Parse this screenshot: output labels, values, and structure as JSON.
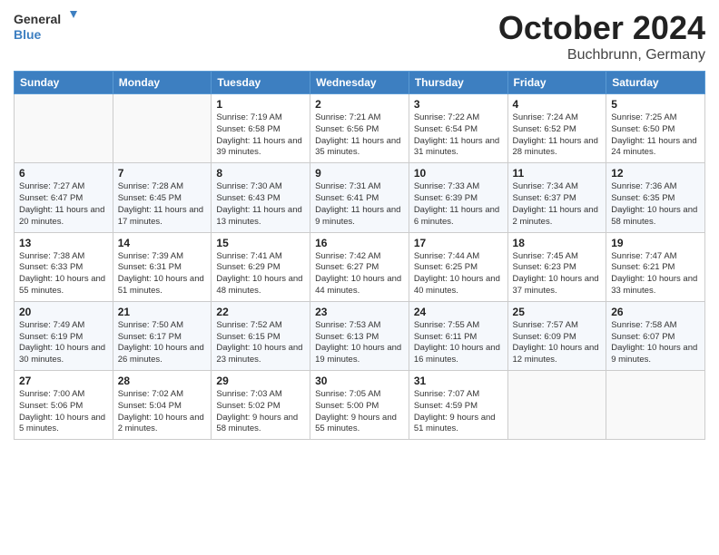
{
  "logo": {
    "line1": "General",
    "line2": "Blue"
  },
  "title": "October 2024",
  "subtitle": "Buchbrunn, Germany",
  "weekdays": [
    "Sunday",
    "Monday",
    "Tuesday",
    "Wednesday",
    "Thursday",
    "Friday",
    "Saturday"
  ],
  "weeks": [
    [
      {
        "day": "",
        "sunrise": "",
        "sunset": "",
        "daylight": ""
      },
      {
        "day": "",
        "sunrise": "",
        "sunset": "",
        "daylight": ""
      },
      {
        "day": "1",
        "sunrise": "Sunrise: 7:19 AM",
        "sunset": "Sunset: 6:58 PM",
        "daylight": "Daylight: 11 hours and 39 minutes."
      },
      {
        "day": "2",
        "sunrise": "Sunrise: 7:21 AM",
        "sunset": "Sunset: 6:56 PM",
        "daylight": "Daylight: 11 hours and 35 minutes."
      },
      {
        "day": "3",
        "sunrise": "Sunrise: 7:22 AM",
        "sunset": "Sunset: 6:54 PM",
        "daylight": "Daylight: 11 hours and 31 minutes."
      },
      {
        "day": "4",
        "sunrise": "Sunrise: 7:24 AM",
        "sunset": "Sunset: 6:52 PM",
        "daylight": "Daylight: 11 hours and 28 minutes."
      },
      {
        "day": "5",
        "sunrise": "Sunrise: 7:25 AM",
        "sunset": "Sunset: 6:50 PM",
        "daylight": "Daylight: 11 hours and 24 minutes."
      }
    ],
    [
      {
        "day": "6",
        "sunrise": "Sunrise: 7:27 AM",
        "sunset": "Sunset: 6:47 PM",
        "daylight": "Daylight: 11 hours and 20 minutes."
      },
      {
        "day": "7",
        "sunrise": "Sunrise: 7:28 AM",
        "sunset": "Sunset: 6:45 PM",
        "daylight": "Daylight: 11 hours and 17 minutes."
      },
      {
        "day": "8",
        "sunrise": "Sunrise: 7:30 AM",
        "sunset": "Sunset: 6:43 PM",
        "daylight": "Daylight: 11 hours and 13 minutes."
      },
      {
        "day": "9",
        "sunrise": "Sunrise: 7:31 AM",
        "sunset": "Sunset: 6:41 PM",
        "daylight": "Daylight: 11 hours and 9 minutes."
      },
      {
        "day": "10",
        "sunrise": "Sunrise: 7:33 AM",
        "sunset": "Sunset: 6:39 PM",
        "daylight": "Daylight: 11 hours and 6 minutes."
      },
      {
        "day": "11",
        "sunrise": "Sunrise: 7:34 AM",
        "sunset": "Sunset: 6:37 PM",
        "daylight": "Daylight: 11 hours and 2 minutes."
      },
      {
        "day": "12",
        "sunrise": "Sunrise: 7:36 AM",
        "sunset": "Sunset: 6:35 PM",
        "daylight": "Daylight: 10 hours and 58 minutes."
      }
    ],
    [
      {
        "day": "13",
        "sunrise": "Sunrise: 7:38 AM",
        "sunset": "Sunset: 6:33 PM",
        "daylight": "Daylight: 10 hours and 55 minutes."
      },
      {
        "day": "14",
        "sunrise": "Sunrise: 7:39 AM",
        "sunset": "Sunset: 6:31 PM",
        "daylight": "Daylight: 10 hours and 51 minutes."
      },
      {
        "day": "15",
        "sunrise": "Sunrise: 7:41 AM",
        "sunset": "Sunset: 6:29 PM",
        "daylight": "Daylight: 10 hours and 48 minutes."
      },
      {
        "day": "16",
        "sunrise": "Sunrise: 7:42 AM",
        "sunset": "Sunset: 6:27 PM",
        "daylight": "Daylight: 10 hours and 44 minutes."
      },
      {
        "day": "17",
        "sunrise": "Sunrise: 7:44 AM",
        "sunset": "Sunset: 6:25 PM",
        "daylight": "Daylight: 10 hours and 40 minutes."
      },
      {
        "day": "18",
        "sunrise": "Sunrise: 7:45 AM",
        "sunset": "Sunset: 6:23 PM",
        "daylight": "Daylight: 10 hours and 37 minutes."
      },
      {
        "day": "19",
        "sunrise": "Sunrise: 7:47 AM",
        "sunset": "Sunset: 6:21 PM",
        "daylight": "Daylight: 10 hours and 33 minutes."
      }
    ],
    [
      {
        "day": "20",
        "sunrise": "Sunrise: 7:49 AM",
        "sunset": "Sunset: 6:19 PM",
        "daylight": "Daylight: 10 hours and 30 minutes."
      },
      {
        "day": "21",
        "sunrise": "Sunrise: 7:50 AM",
        "sunset": "Sunset: 6:17 PM",
        "daylight": "Daylight: 10 hours and 26 minutes."
      },
      {
        "day": "22",
        "sunrise": "Sunrise: 7:52 AM",
        "sunset": "Sunset: 6:15 PM",
        "daylight": "Daylight: 10 hours and 23 minutes."
      },
      {
        "day": "23",
        "sunrise": "Sunrise: 7:53 AM",
        "sunset": "Sunset: 6:13 PM",
        "daylight": "Daylight: 10 hours and 19 minutes."
      },
      {
        "day": "24",
        "sunrise": "Sunrise: 7:55 AM",
        "sunset": "Sunset: 6:11 PM",
        "daylight": "Daylight: 10 hours and 16 minutes."
      },
      {
        "day": "25",
        "sunrise": "Sunrise: 7:57 AM",
        "sunset": "Sunset: 6:09 PM",
        "daylight": "Daylight: 10 hours and 12 minutes."
      },
      {
        "day": "26",
        "sunrise": "Sunrise: 7:58 AM",
        "sunset": "Sunset: 6:07 PM",
        "daylight": "Daylight: 10 hours and 9 minutes."
      }
    ],
    [
      {
        "day": "27",
        "sunrise": "Sunrise: 7:00 AM",
        "sunset": "Sunset: 5:06 PM",
        "daylight": "Daylight: 10 hours and 5 minutes."
      },
      {
        "day": "28",
        "sunrise": "Sunrise: 7:02 AM",
        "sunset": "Sunset: 5:04 PM",
        "daylight": "Daylight: 10 hours and 2 minutes."
      },
      {
        "day": "29",
        "sunrise": "Sunrise: 7:03 AM",
        "sunset": "Sunset: 5:02 PM",
        "daylight": "Daylight: 9 hours and 58 minutes."
      },
      {
        "day": "30",
        "sunrise": "Sunrise: 7:05 AM",
        "sunset": "Sunset: 5:00 PM",
        "daylight": "Daylight: 9 hours and 55 minutes."
      },
      {
        "day": "31",
        "sunrise": "Sunrise: 7:07 AM",
        "sunset": "Sunset: 4:59 PM",
        "daylight": "Daylight: 9 hours and 51 minutes."
      },
      {
        "day": "",
        "sunrise": "",
        "sunset": "",
        "daylight": ""
      },
      {
        "day": "",
        "sunrise": "",
        "sunset": "",
        "daylight": ""
      }
    ]
  ]
}
